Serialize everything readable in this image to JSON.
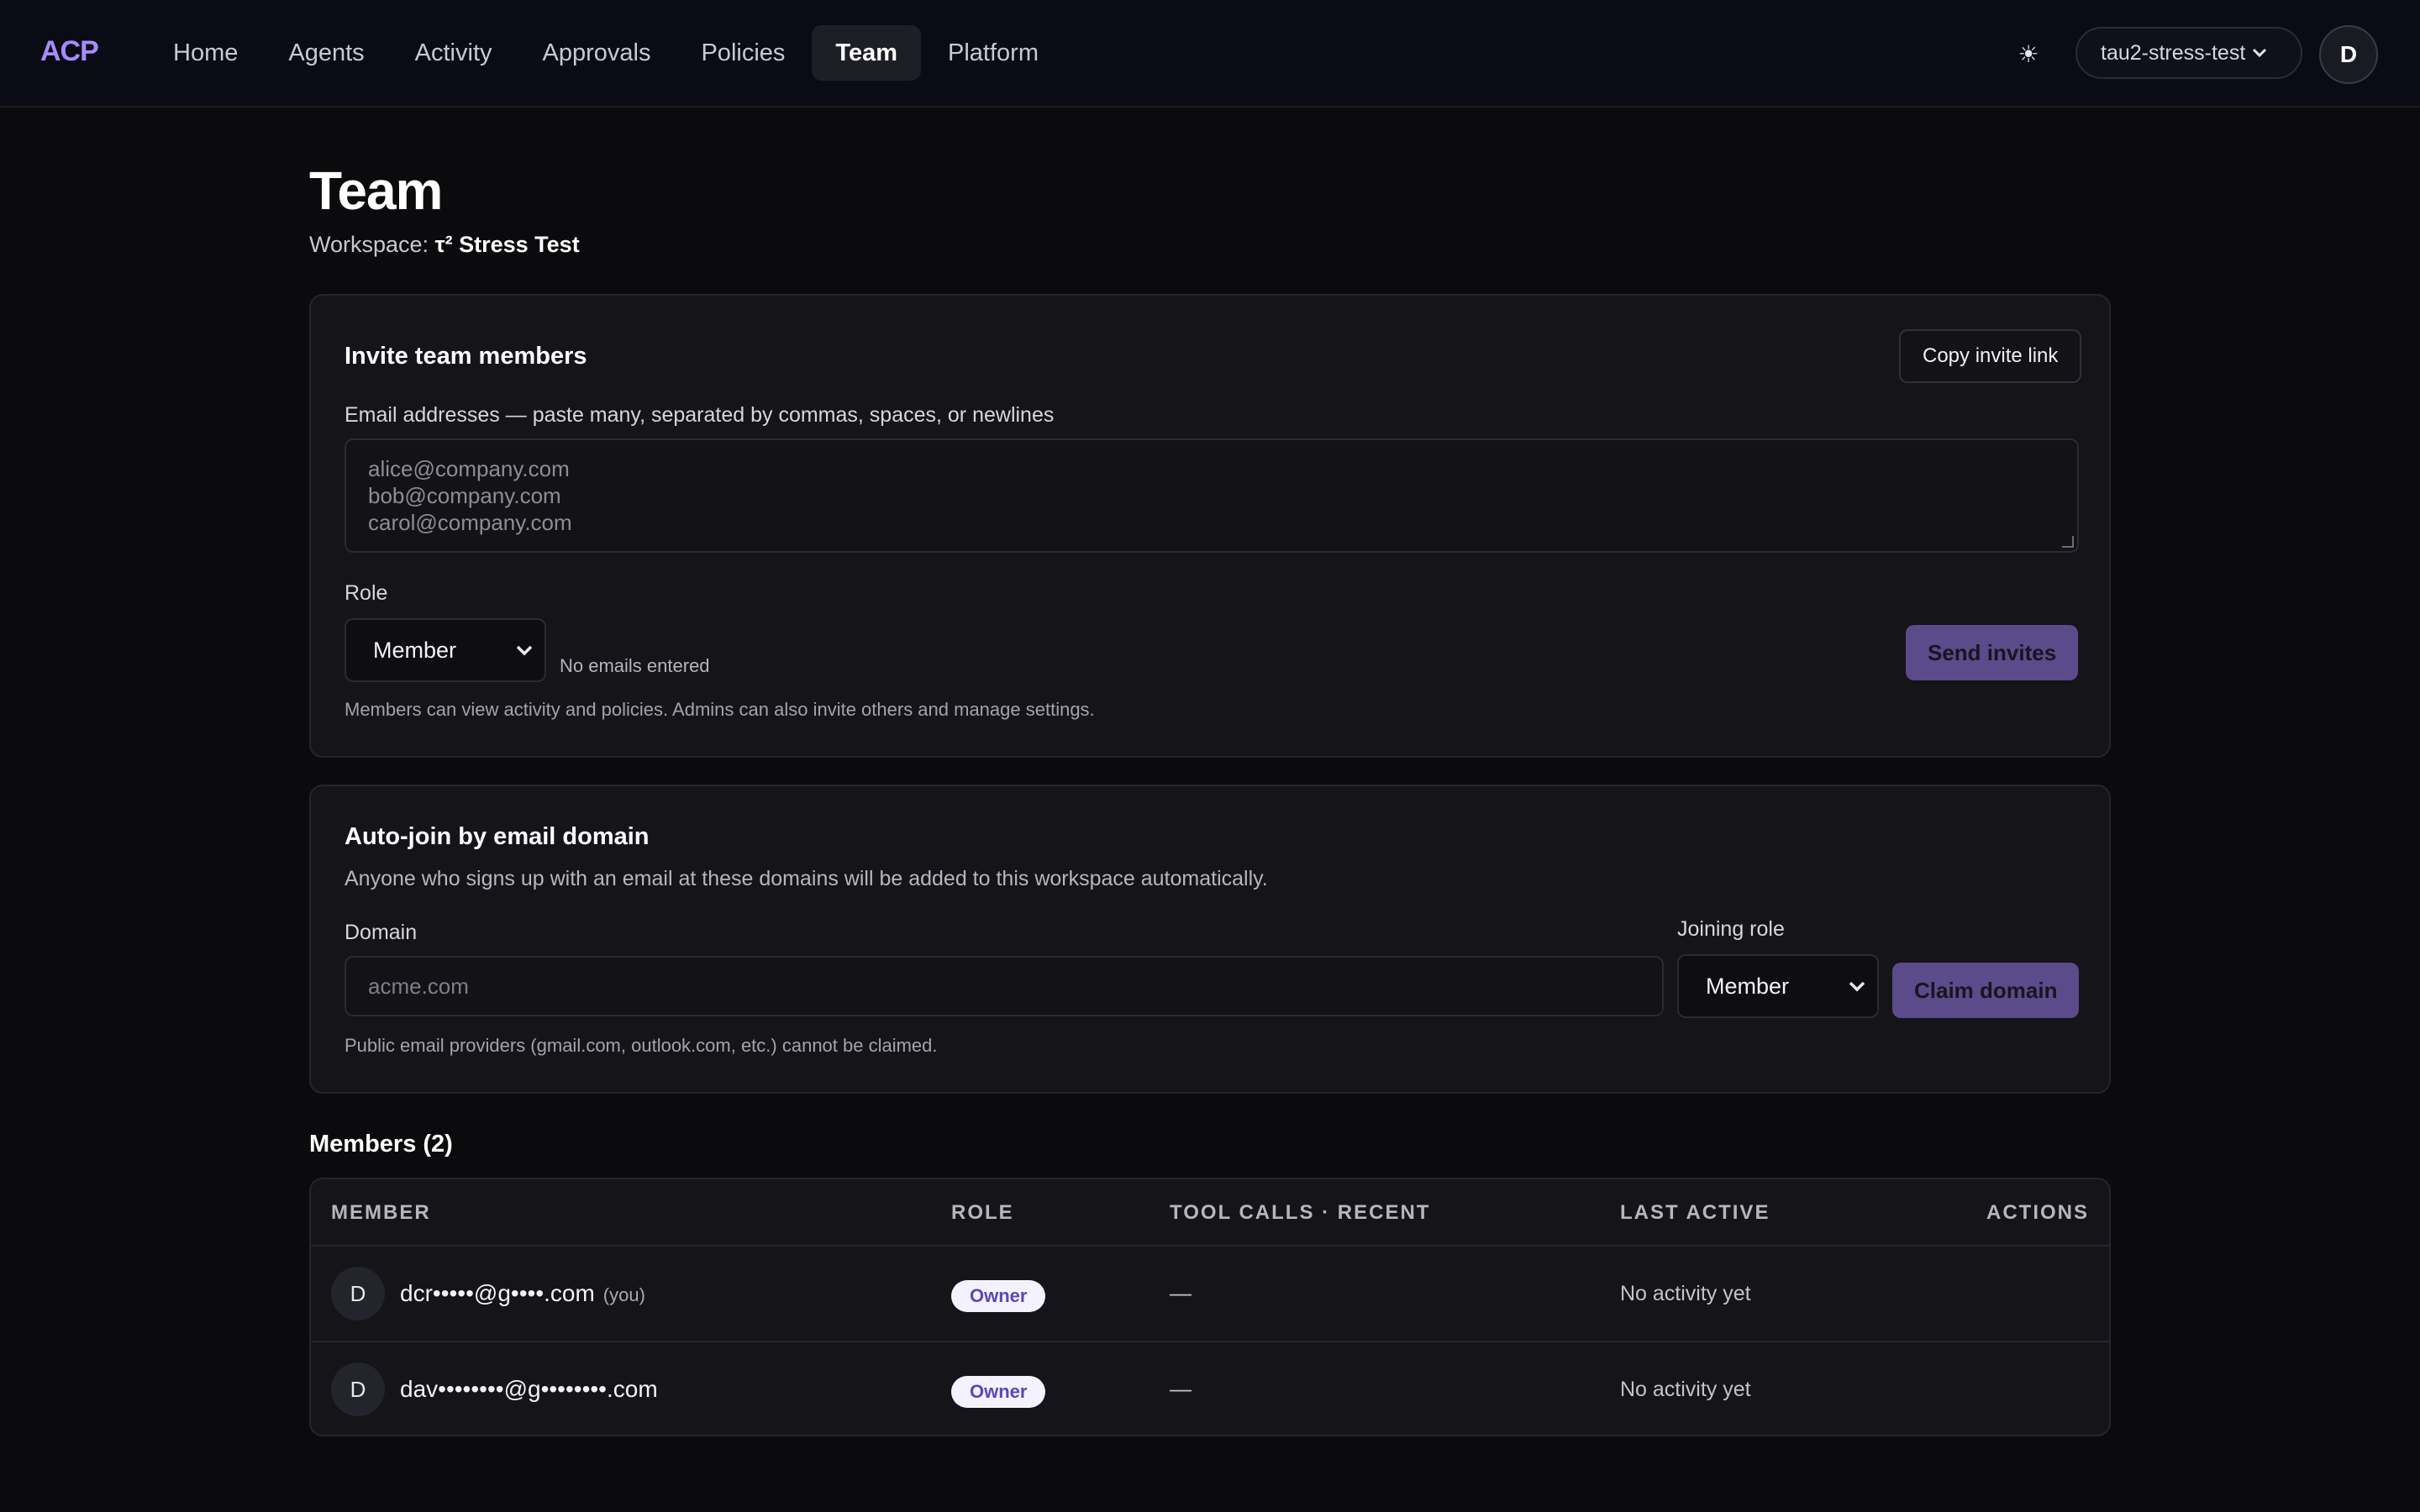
{
  "app": {
    "logo": "ACP"
  },
  "nav": {
    "items": [
      {
        "label": "Home"
      },
      {
        "label": "Agents"
      },
      {
        "label": "Activity"
      },
      {
        "label": "Approvals"
      },
      {
        "label": "Policies"
      },
      {
        "label": "Team",
        "active": true
      },
      {
        "label": "Platform"
      }
    ],
    "theme_icon": "sun-icon",
    "theme_glyph": "☀",
    "workspace_selector": "tau2-stress-test",
    "workspace_chevron": "⌄",
    "user_initial": "D"
  },
  "page": {
    "title": "Team",
    "workspace_label": "Workspace:",
    "workspace_name": "τ² Stress Test"
  },
  "invite": {
    "title": "Invite team members",
    "copy_link_label": "Copy invite link",
    "emails_label": "Email addresses — paste many, separated by commas, spaces, or newlines",
    "emails_placeholder": [
      "alice@company.com",
      "bob@company.com",
      "carol@company.com"
    ],
    "role_label": "Role",
    "role_value": "Member",
    "no_emails": "No emails entered",
    "send_label": "Send invites",
    "role_hint": "Members can view activity and policies. Admins can also invite others and manage settings."
  },
  "autojoin": {
    "title": "Auto-join by email domain",
    "description": "Anyone who signs up with an email at these domains will be added to this workspace automatically.",
    "domain_label": "Domain",
    "domain_placeholder": "acme.com",
    "joining_role_label": "Joining role",
    "joining_role_value": "Member",
    "claim_label": "Claim domain",
    "hint": "Public email providers (gmail.com, outlook.com, etc.) cannot be claimed."
  },
  "members": {
    "title": "Members (2)",
    "columns": [
      "MEMBER",
      "ROLE",
      "TOOL CALLS · RECENT",
      "LAST ACTIVE",
      "ACTIONS"
    ],
    "rows": [
      {
        "initial": "D",
        "email": "dcr•••••@g••••.com",
        "you": "(you)",
        "role": "Owner",
        "tool_calls": "—",
        "last_active": "No activity yet"
      },
      {
        "initial": "D",
        "email": "dav••••••••@g••••••••.com",
        "you": "",
        "role": "Owner",
        "tool_calls": "—",
        "last_active": "No activity yet"
      }
    ]
  },
  "colors": {
    "accent": "#a78bfa",
    "primary_button": "#5b4b8a",
    "badge_bg": "#f4f2ff",
    "badge_text": "#5b47b8"
  }
}
